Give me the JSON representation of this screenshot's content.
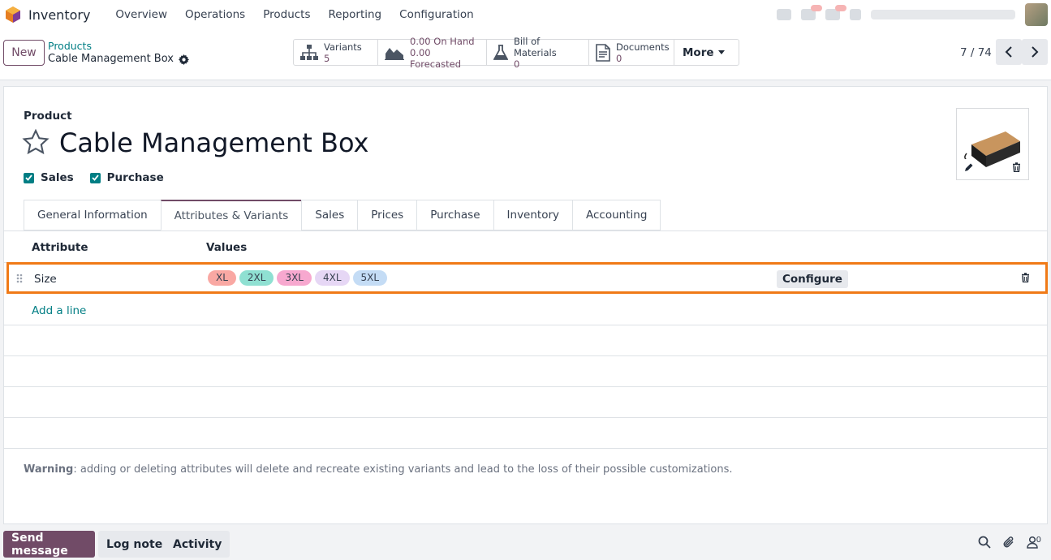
{
  "app": {
    "name": "Inventory",
    "menu": [
      "Overview",
      "Operations",
      "Products",
      "Reporting",
      "Configuration"
    ]
  },
  "control": {
    "new_label": "New",
    "breadcrumb_parent": "Products",
    "breadcrumb_current": "Cable Management Box",
    "smart_buttons": {
      "variants": {
        "label": "Variants",
        "value": "5"
      },
      "on_hand": {
        "label": "0.00 On Hand",
        "value": "0.00 Forecasted"
      },
      "bom": {
        "label": "Bill of Materials",
        "value": "0"
      },
      "documents": {
        "label": "Documents",
        "value": "0"
      },
      "more": "More"
    },
    "pager": "7 / 74"
  },
  "form": {
    "product_label": "Product",
    "title": "Cable Management Box",
    "sales_label": "Sales",
    "purchase_label": "Purchase",
    "sales_checked": true,
    "purchase_checked": true
  },
  "tabs": [
    "General Information",
    "Attributes & Variants",
    "Sales",
    "Prices",
    "Purchase",
    "Inventory",
    "Accounting"
  ],
  "active_tab": "Attributes & Variants",
  "attributes": {
    "col_attribute": "Attribute",
    "col_values": "Values",
    "row": {
      "attribute": "Size",
      "values": [
        {
          "label": "XL",
          "color": "#f9a8a3"
        },
        {
          "label": "2XL",
          "color": "#8fe0d2"
        },
        {
          "label": "3XL",
          "color": "#f7a8cf"
        },
        {
          "label": "4XL",
          "color": "#e6d7f5"
        },
        {
          "label": "5XL",
          "color": "#c4dcf5"
        }
      ],
      "configure_label": "Configure"
    },
    "add_line": "Add a line"
  },
  "warning": {
    "bold": "Warning",
    "text": ": adding or deleting attributes will delete and recreate existing variants and lead to the loss of their possible customizations."
  },
  "chatter": {
    "send_message": "Send message",
    "log_note": "Log note",
    "activity": "Activity",
    "followers_count": "0"
  },
  "colors": {
    "brand": "#714b67",
    "accent": "#017e84",
    "highlight": "#f07a17"
  }
}
